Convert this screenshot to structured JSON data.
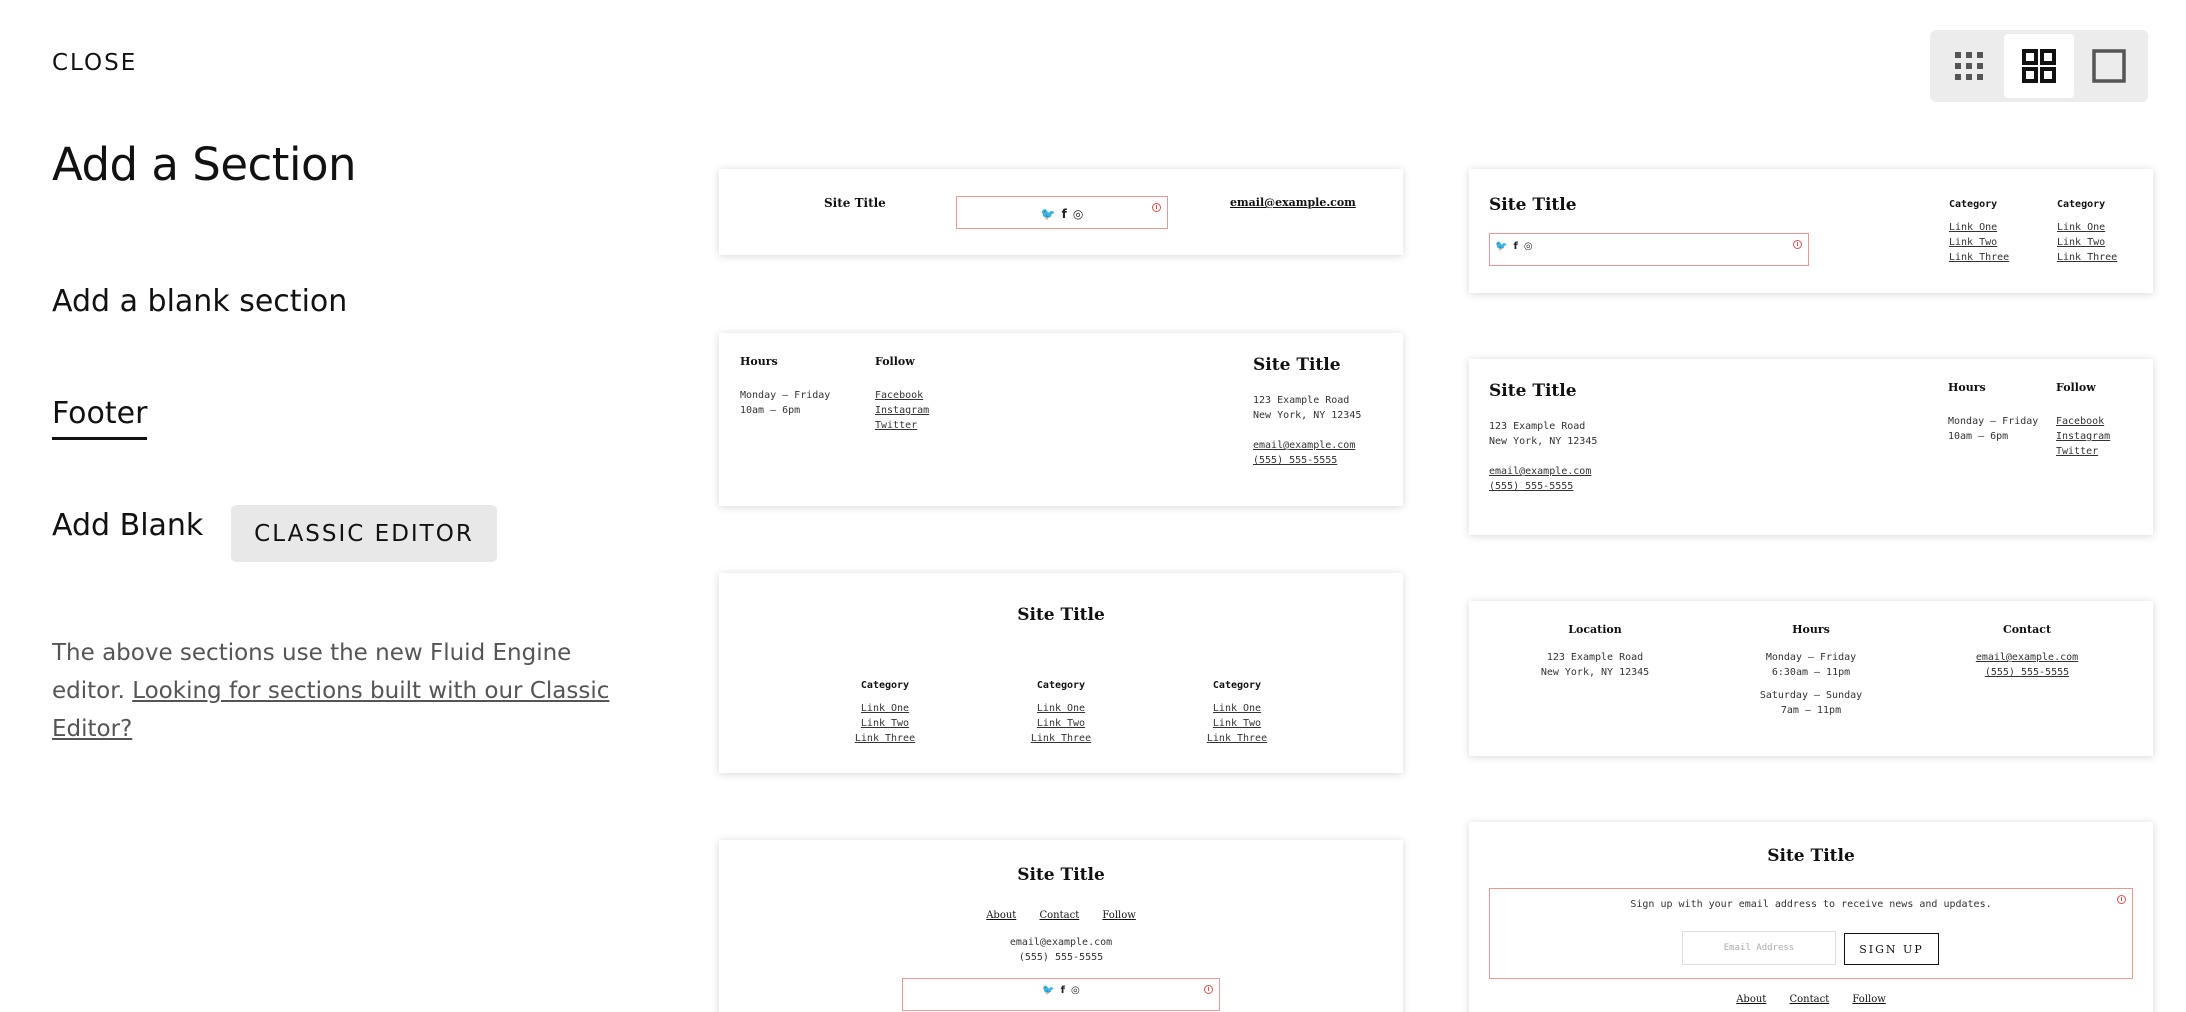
{
  "header": {
    "close_label": "CLOSE",
    "title": "Add a Section"
  },
  "nav": {
    "blank_section": "Add a blank section",
    "footer": "Footer",
    "add_blank": "Add Blank",
    "classic_editor_button": "CLASSIC EDITOR"
  },
  "note": {
    "text": "The above sections use the new Fluid Engine editor. ",
    "link": "Looking for sections built with our Classic Editor?"
  },
  "view_toggle": {
    "options": [
      {
        "icon": "small-grid-icon",
        "active": false
      },
      {
        "icon": "large-grid-icon",
        "active": true
      },
      {
        "icon": "single-view-icon",
        "active": false
      }
    ]
  },
  "cards": {
    "c1": {
      "site_title": "Site Title",
      "email": "email@example.com",
      "social": [
        "twitter",
        "facebook",
        "instagram"
      ]
    },
    "c2": {
      "site_title": "Site Title",
      "social": [
        "twitter",
        "facebook",
        "instagram"
      ],
      "col1": {
        "heading": "Category",
        "links": [
          "Link One",
          "Link Two",
          "Link Three"
        ]
      },
      "col2": {
        "heading": "Category",
        "links": [
          "Link One",
          "Link Two",
          "Link Three"
        ]
      }
    },
    "c3": {
      "hours_heading": "Hours",
      "hours_line1": "Monday – Friday",
      "hours_line2": "10am – 6pm",
      "follow_heading": "Follow",
      "follow_links": [
        "Facebook",
        "Instagram",
        "Twitter"
      ],
      "site_title": "Site Title",
      "address1": "123 Example Road",
      "address2": "New York, NY 12345",
      "email": "email@example.com",
      "phone": "(555) 555-5555"
    },
    "c4": {
      "site_title": "Site Title",
      "address1": "123 Example Road",
      "address2": "New York, NY 12345",
      "email": "email@example.com",
      "phone": "(555) 555-5555",
      "hours_heading": "Hours",
      "hours_line1": "Monday – Friday",
      "hours_line2": "10am – 6pm",
      "follow_heading": "Follow",
      "follow_links": [
        "Facebook",
        "Instagram",
        "Twitter"
      ]
    },
    "c5": {
      "site_title": "Site Title",
      "columns": [
        {
          "heading": "Category",
          "links": [
            "Link One",
            "Link Two",
            "Link Three"
          ]
        },
        {
          "heading": "Category",
          "links": [
            "Link One",
            "Link Two",
            "Link Three"
          ]
        },
        {
          "heading": "Category",
          "links": [
            "Link One",
            "Link Two",
            "Link Three"
          ]
        }
      ]
    },
    "c6": {
      "location_heading": "Location",
      "address1": "123 Example Road",
      "address2": "New York, NY 12345",
      "hours_heading": "Hours",
      "hours1": "Monday – Friday",
      "hours2": "6:30am – 11pm",
      "hours3": "Saturday – Sunday",
      "hours4": "7am – 11pm",
      "contact_heading": "Contact",
      "email": "email@example.com",
      "phone": "(555) 555-5555"
    },
    "c7": {
      "site_title": "Site Title",
      "nav": [
        "About",
        "Contact",
        "Follow"
      ],
      "email": "email@example.com",
      "phone": "(555) 555-5555",
      "social": [
        "twitter",
        "facebook",
        "instagram"
      ]
    },
    "c8": {
      "site_title": "Site Title",
      "signup_text": "Sign up with your email address to receive news and updates.",
      "email_placeholder": "Email Address",
      "signup_button": "SIGN UP",
      "nav": [
        "About",
        "Contact",
        "Follow"
      ]
    }
  },
  "colors": {
    "warning_border": "#e99a92",
    "warning_icon": "#d9534f",
    "toggle_bg": "#ececec"
  }
}
